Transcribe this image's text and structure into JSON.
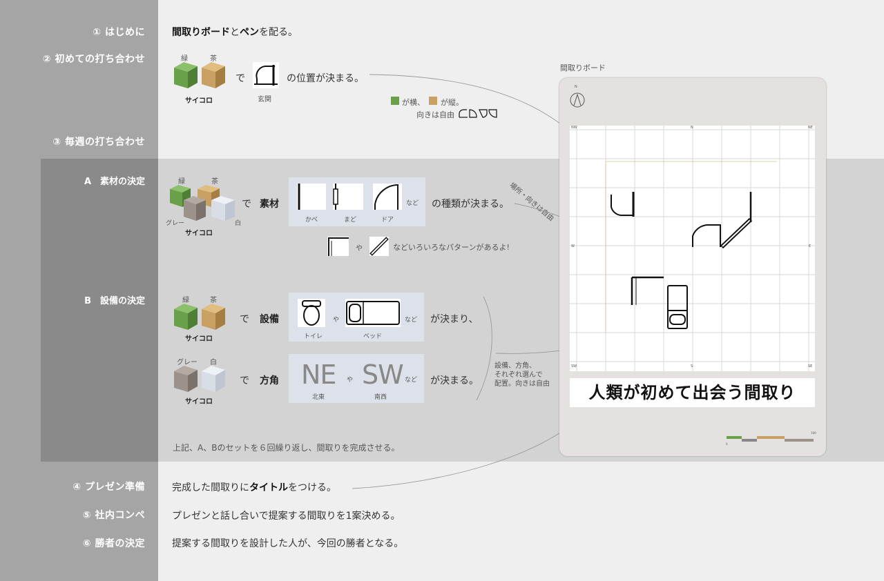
{
  "steps": {
    "s1": "① はじめに",
    "s2": "② 初めての打ち合わせ",
    "s3": "③ 毎週の打ち合わせ",
    "sa": "A　素材の決定",
    "sb": "B　設備の決定",
    "s4": "④ プレゼン準備",
    "s5": "⑤ 社内コンペ",
    "s6": "⑥ 勝者の決定"
  },
  "step1": {
    "pre": "間取りボード",
    "mid": "と",
    "bold2": "ペン",
    "post": "を配る。"
  },
  "step2": {
    "green": "緑",
    "tea": "茶",
    "dice": "サイコロ",
    "de": "で",
    "entrance": "玄関",
    "result": "の位置が決まる。",
    "note1": "が横、",
    "note2": "が縦。",
    "note3": "向きは自由"
  },
  "stepA": {
    "green": "緑",
    "tea": "茶",
    "gray": "グレー",
    "white": "白",
    "dice": "サイコロ",
    "de": "で",
    "label": "素材",
    "wall": "かべ",
    "window": "まど",
    "door": "ドア",
    "etc": "など",
    "result": "の種類が決まる。",
    "ya": "や",
    "variety": "などいろいろなパターンがあるよ!",
    "arrow_note": "場所・向きは自由"
  },
  "stepB": {
    "green": "緑",
    "tea": "茶",
    "dice": "サイコロ",
    "de": "で",
    "label": "設備",
    "toilet": "トイレ",
    "ya": "や",
    "bed": "ベッド",
    "etc": "など",
    "result": "が決まり、",
    "gray": "グレー",
    "white": "白",
    "dice2": "サイコロ",
    "de2": "で",
    "label2": "方角",
    "ne": "NE",
    "ne_sub": "北東",
    "ya2": "や",
    "sw": "SW",
    "sw_sub": "南西",
    "etc2": "など",
    "result2": "が決まる。",
    "side_note1": "設備、方角、",
    "side_note2": "それぞれ選んで",
    "side_note3": "配置。向きは自由"
  },
  "repeat_note": "上記、A、Bのセットを６回繰り返し、間取りを完成させる。",
  "step4": {
    "pre": "完成した間取りに",
    "bold": "タイトル",
    "post": "をつける。"
  },
  "step5": "プレゼンと話し合いで提案する間取りを1案決める。",
  "step6": "提案する間取りを設計した人が、今回の勝者となる。",
  "board": {
    "caption": "間取りボード",
    "title": "人類が初めて出会う間取り",
    "compass_n": "N",
    "dir_nw": "NW",
    "dir_n": "N",
    "dir_ne": "NE",
    "dir_w": "W",
    "dir_e": "E",
    "dir_sw": "SW",
    "dir_s": "S",
    "dir_se": "SE",
    "scale_start": "0",
    "scale_end": "100"
  },
  "colors": {
    "green": "#6aa04a",
    "tea": "#c9a063",
    "gray": "#9b928a",
    "white": "#d9dee6"
  }
}
